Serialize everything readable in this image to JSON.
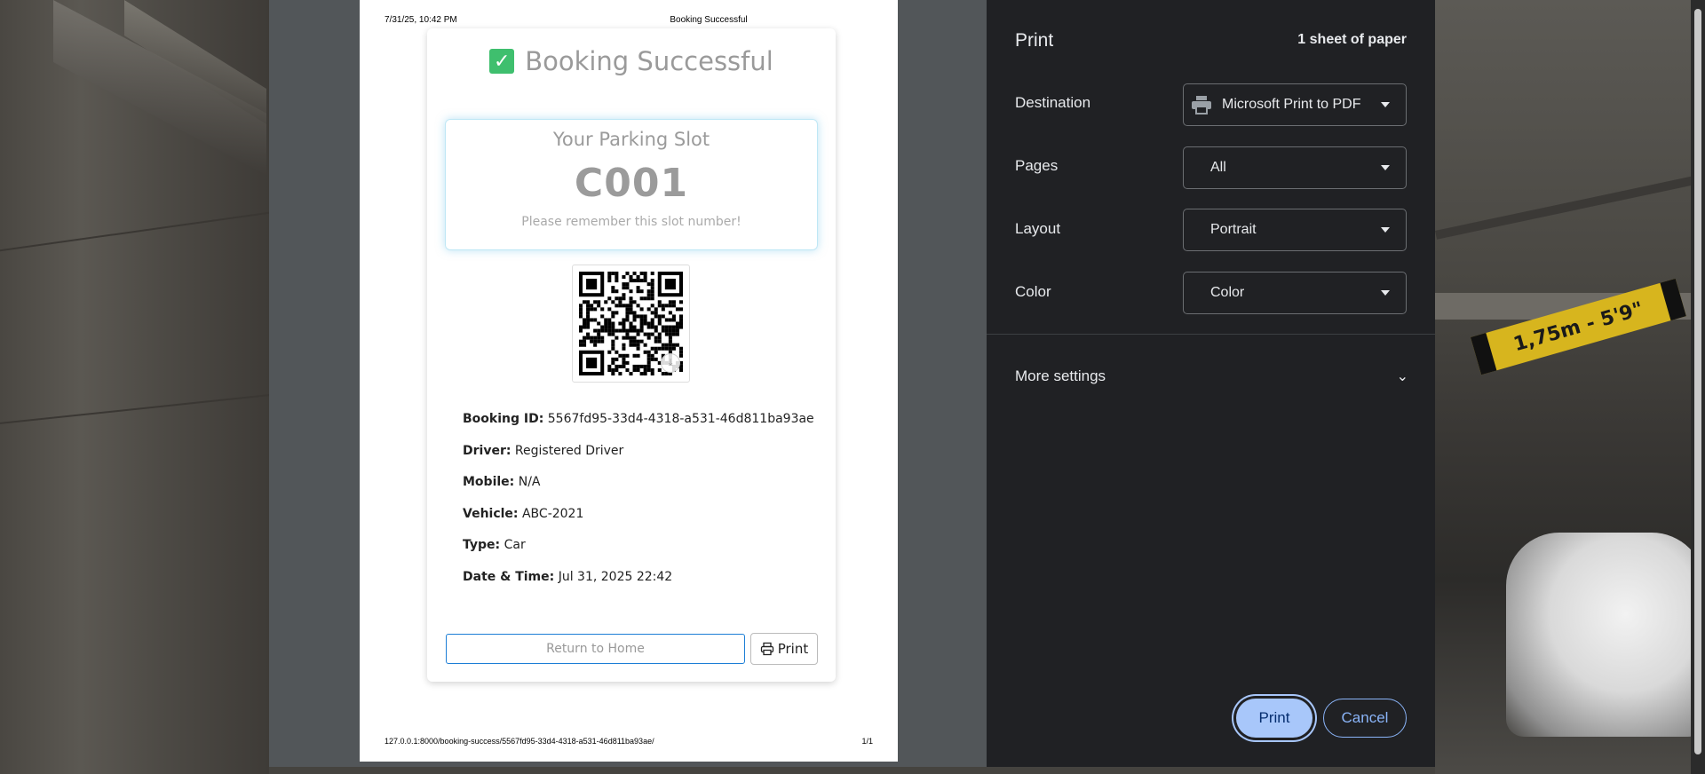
{
  "paper": {
    "header_date": "7/31/25, 10:42 PM",
    "header_title": "Booking Successful",
    "footer_url": "127.0.0.1:8000/booking-success/5567fd95-33d4-4318-a531-46d811ba93ae/",
    "footer_page": "1/1"
  },
  "page": {
    "success_title": "Booking Successful",
    "slot_label": "Your Parking Slot",
    "slot_number": "C001",
    "slot_note": "Please remember this slot number!",
    "details": [
      {
        "label": "Booking ID:",
        "value": "5567fd95-33d4-4318-a531-46d811ba93ae"
      },
      {
        "label": "Driver:",
        "value": "Registered Driver"
      },
      {
        "label": "Mobile:",
        "value": "N/A"
      },
      {
        "label": "Vehicle:",
        "value": "ABC-2021"
      },
      {
        "label": "Type:",
        "value": "Car"
      },
      {
        "label": "Date & Time:",
        "value": "Jul 31, 2025 22:42"
      }
    ],
    "return_button": "Return to Home",
    "print_button": "Print"
  },
  "print_panel": {
    "title": "Print",
    "sheets": "1 sheet of paper",
    "destination_label": "Destination",
    "destination_value": "Microsoft Print to PDF",
    "pages_label": "Pages",
    "pages_value": "All",
    "layout_label": "Layout",
    "layout_value": "Portrait",
    "color_label": "Color",
    "color_value": "Color",
    "more_settings": "More settings",
    "print_button": "Print",
    "cancel_button": "Cancel"
  },
  "background": {
    "clearance_sign": "1,75m - 5'9\""
  },
  "colors": {
    "panel_bg": "#202124",
    "accent": "#a8c7fa",
    "success_green": "#3fbf6e",
    "preview_gray": "#525659"
  }
}
